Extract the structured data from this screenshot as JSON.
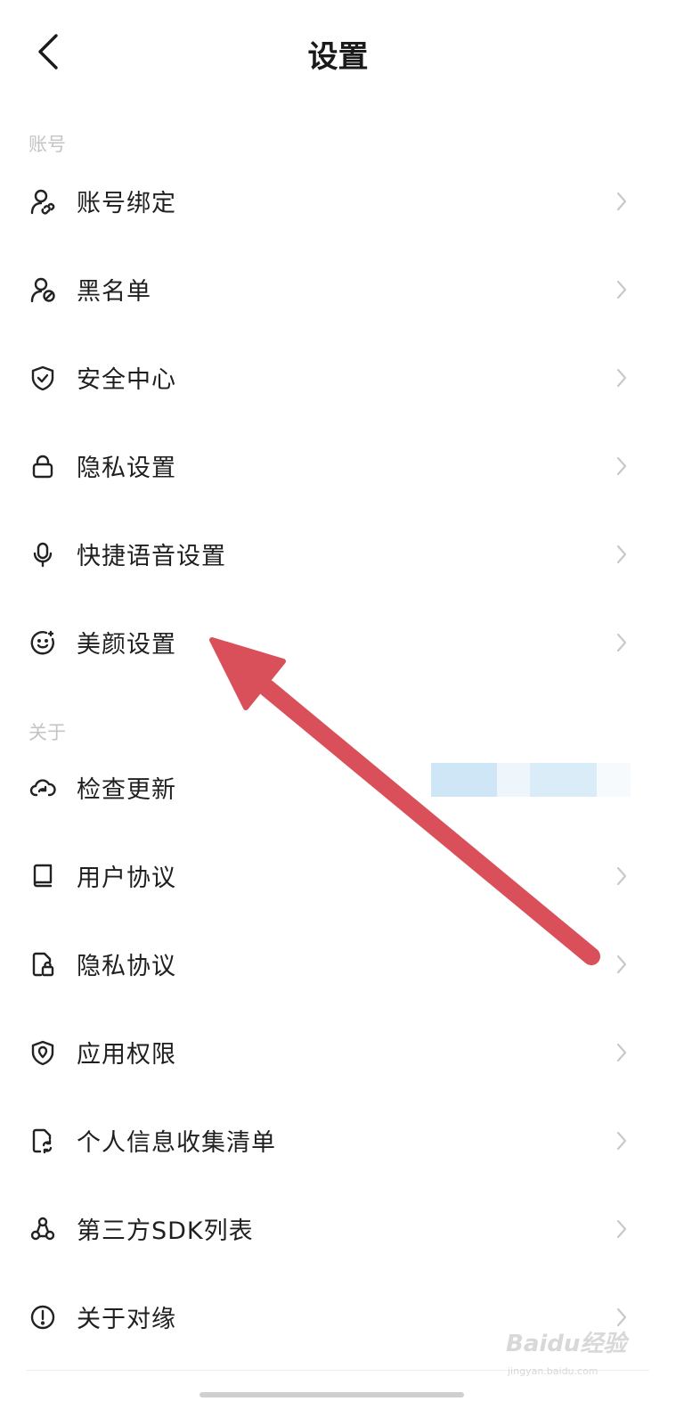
{
  "header": {
    "title": "设置",
    "back_icon": "chevron-left-icon"
  },
  "sections": [
    {
      "label": "账号"
    },
    {
      "label": "关于"
    }
  ],
  "items": [
    {
      "label": "账号绑定",
      "icon": "account-link-icon"
    },
    {
      "label": "黑名单",
      "icon": "user-block-icon"
    },
    {
      "label": "安全中心",
      "icon": "shield-check-icon"
    },
    {
      "label": "隐私设置",
      "icon": "lock-icon"
    },
    {
      "label": "快捷语音设置",
      "icon": "microphone-icon"
    },
    {
      "label": "美颜设置",
      "icon": "smile-face-icon"
    },
    {
      "label": "检查更新",
      "icon": "cloud-refresh-icon"
    },
    {
      "label": "用户协议",
      "icon": "book-icon"
    },
    {
      "label": "隐私协议",
      "icon": "document-lock-icon"
    },
    {
      "label": "应用权限",
      "icon": "shield-location-icon"
    },
    {
      "label": "个人信息收集清单",
      "icon": "document-sync-icon"
    },
    {
      "label": "第三方SDK列表",
      "icon": "nodes-icon"
    },
    {
      "label": "关于对缘",
      "icon": "info-circle-icon"
    }
  ],
  "colors": {
    "arrow": "#d9505a",
    "update_badge": "#cfe6f6",
    "section_label": "#c4c4c4"
  },
  "watermark": {
    "text": "Baidu经验",
    "sub": "jingyan.baidu.com"
  }
}
